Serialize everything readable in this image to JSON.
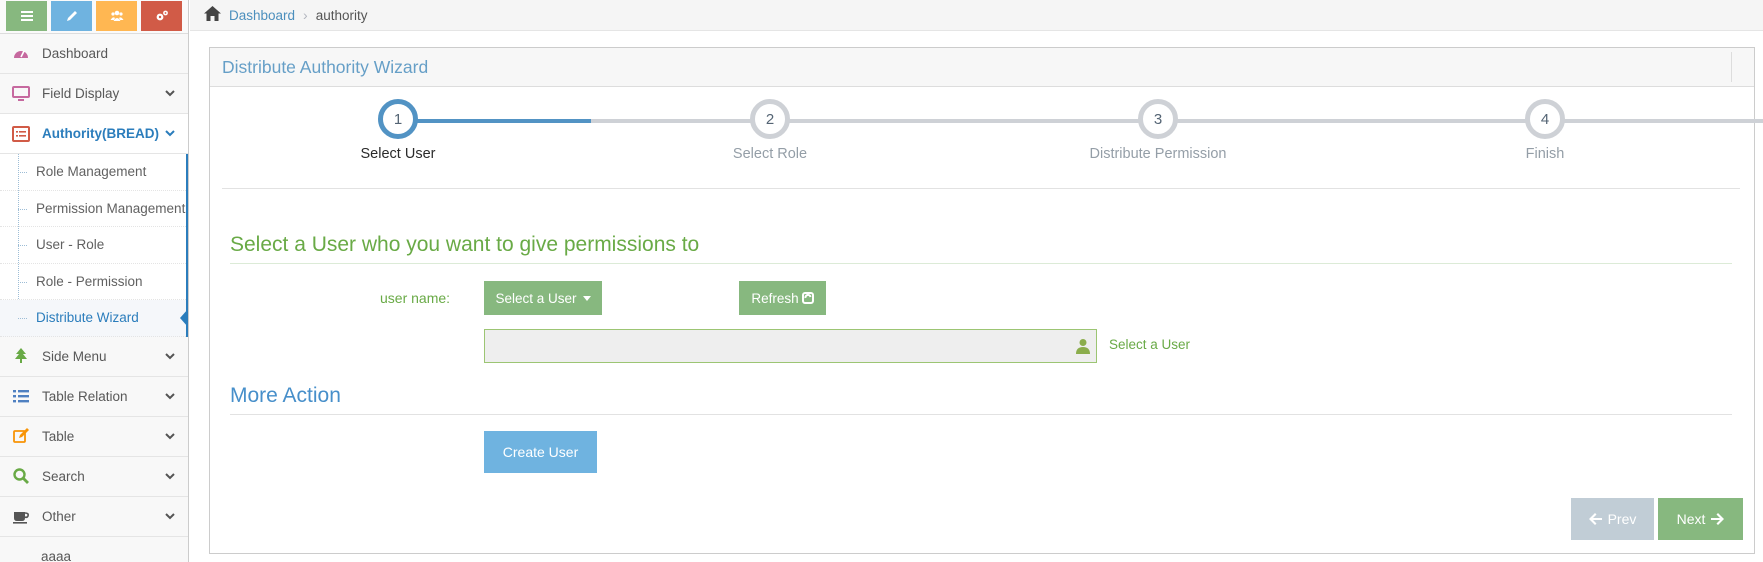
{
  "colors": {
    "shortcut_green": "#87b87f",
    "shortcut_blue": "#6fb3e0",
    "shortcut_orange": "#ffb752",
    "shortcut_red": "#d15b47",
    "accent": "#2b7dbc"
  },
  "sidebar": {
    "shortcuts": [
      {
        "icon": "list-icon"
      },
      {
        "icon": "pencil-icon"
      },
      {
        "icon": "users-icon"
      },
      {
        "icon": "cogs-icon"
      }
    ],
    "items": [
      {
        "label": "Dashboard",
        "icon": "tachometer-icon"
      },
      {
        "label": "Field Display",
        "icon": "desktop-icon"
      },
      {
        "label": "Authority(BREAD)",
        "icon": "list-alt-icon"
      },
      {
        "label": "Side Menu",
        "icon": "tree-icon"
      },
      {
        "label": "Table Relation",
        "icon": "list-icon"
      },
      {
        "label": "Table",
        "icon": "edit-icon"
      },
      {
        "label": "Search",
        "icon": "search-icon"
      },
      {
        "label": "Other",
        "icon": "coffee-icon"
      },
      {
        "label": "aaaa"
      }
    ],
    "submenu": [
      {
        "label": "Role Management"
      },
      {
        "label": "Permission Management"
      },
      {
        "label": "User - Role"
      },
      {
        "label": "Role - Permission"
      },
      {
        "label": "Distribute Wizard"
      }
    ]
  },
  "breadcrumb": {
    "home": "Dashboard",
    "current": "authority"
  },
  "wizard": {
    "title": "Distribute Authority Wizard",
    "steps": [
      {
        "number": "1",
        "label": "Select User"
      },
      {
        "number": "2",
        "label": "Select Role"
      },
      {
        "number": "3",
        "label": "Distribute Permission"
      },
      {
        "number": "4",
        "label": "Finish"
      }
    ],
    "section_title": "Select a User who you want to give permissions to",
    "user_label": "user name:",
    "select_button": "Select a User",
    "refresh_button": "Refresh",
    "input_value": "",
    "input_help": "Select a User",
    "more_title": "More Action",
    "create_button": "Create User",
    "prev_button": "Prev",
    "next_button": "Next"
  }
}
